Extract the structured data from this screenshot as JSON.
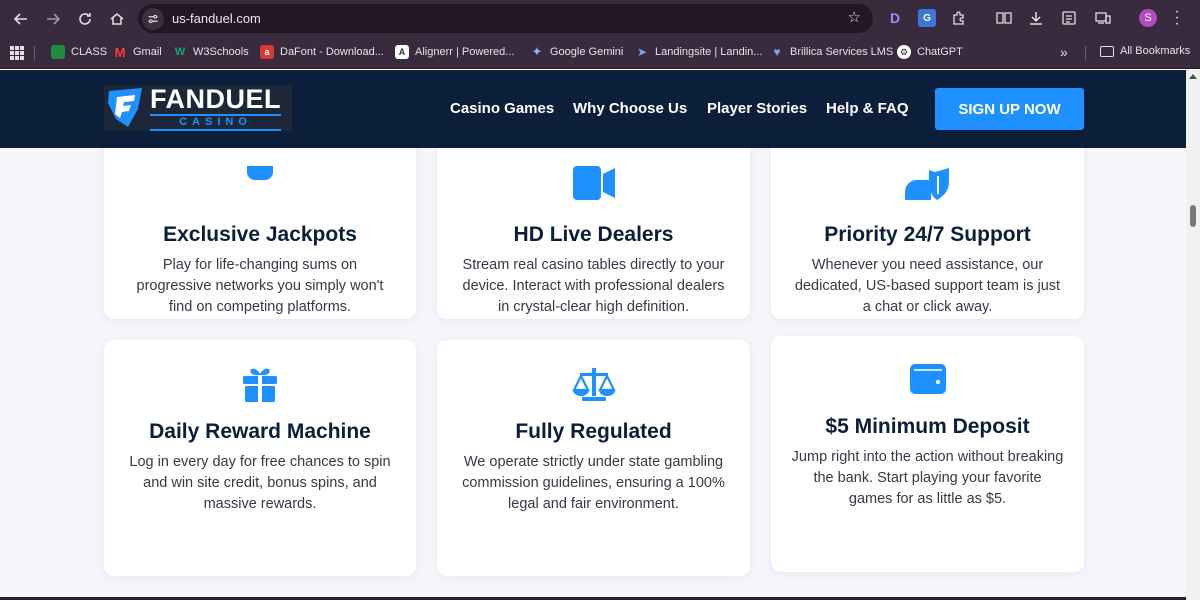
{
  "browser": {
    "url": "us-fanduel.com",
    "profile_initial": "S",
    "bookmarks": [
      {
        "label": "CLASS",
        "icon": "google-classroom-icon"
      },
      {
        "label": "Gmail",
        "icon": "gmail-icon"
      },
      {
        "label": "W3Schools",
        "icon": "w3schools-icon"
      },
      {
        "label": "DaFont - Download...",
        "icon": "dafont-icon"
      },
      {
        "label": "Alignerr | Powered...",
        "icon": "alignerr-icon"
      },
      {
        "label": "Google Gemini",
        "icon": "gemini-icon"
      },
      {
        "label": "Landingsite | Landin...",
        "icon": "landingsite-icon"
      },
      {
        "label": "Brillica Services LMS",
        "icon": "brillica-icon"
      },
      {
        "label": "ChatGPT",
        "icon": "chatgpt-icon"
      }
    ],
    "all_bookmarks": "All Bookmarks"
  },
  "site": {
    "logo_name": "FANDUEL",
    "logo_sub": "CASINO",
    "nav": [
      "Casino Games",
      "Why Choose Us",
      "Player Stories",
      "Help & FAQ"
    ],
    "cta": "SIGN UP NOW",
    "accent": "#1e90ff",
    "header_bg": "#0b1f3a"
  },
  "features": [
    {
      "icon": "trophy-icon",
      "title": "Exclusive Jackpots",
      "desc": "Play for life-changing sums on progressive networks you simply won't find on competing platforms."
    },
    {
      "icon": "video-camera-icon",
      "title": "HD Live Dealers",
      "desc": "Stream real casino tables directly to your device. Interact with professional dealers in crystal-clear high definition."
    },
    {
      "icon": "user-shield-icon",
      "title": "Priority 24/7 Support",
      "desc": "Whenever you need assistance, our dedicated, US-based support team is just a chat or click away."
    },
    {
      "icon": "gift-icon",
      "title": "Daily Reward Machine",
      "desc": "Log in every day for free chances to spin and win site credit, bonus spins, and massive rewards."
    },
    {
      "icon": "scale-balance-icon",
      "title": "Fully Regulated",
      "desc": "We operate strictly under state gambling commission guidelines, ensuring a 100% legal and fair environment."
    },
    {
      "icon": "wallet-icon",
      "title": "$5 Minimum Deposit",
      "desc": "Jump right into the action without breaking the bank. Start playing your favorite games for as little as $5."
    }
  ]
}
